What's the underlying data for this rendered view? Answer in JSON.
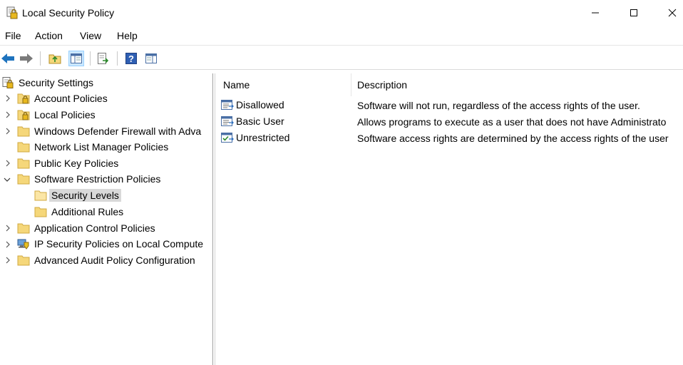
{
  "window": {
    "title": "Local Security Policy",
    "app_icon": "security-policy-icon"
  },
  "menu": [
    "File",
    "Action",
    "View",
    "Help"
  ],
  "toolbar": {
    "icons": [
      "back-icon",
      "forward-icon",
      "up-folder-icon",
      "show-hide-tree-icon",
      "export-list-icon",
      "help-icon",
      "properties-pane-icon"
    ]
  },
  "tree": {
    "root": "Security Settings",
    "items": [
      {
        "label": "Account Policies"
      },
      {
        "label": "Local Policies"
      },
      {
        "label": "Windows Defender Firewall with Adva"
      },
      {
        "label": "Network List Manager Policies"
      },
      {
        "label": "Public Key Policies"
      },
      {
        "label": "Software Restriction Policies"
      },
      {
        "label": "Security Levels"
      },
      {
        "label": "Additional Rules"
      },
      {
        "label": "Application Control Policies"
      },
      {
        "label": "IP Security Policies on Local Compute"
      },
      {
        "label": "Advanced Audit Policy Configuration"
      }
    ]
  },
  "list": {
    "columns": [
      "Name",
      "Description"
    ],
    "rows": [
      {
        "name": "Disallowed",
        "description": "Software will not run, regardless of the access rights of the user."
      },
      {
        "name": "Basic User",
        "description": "Allows programs to execute as a user that does not have Administrato"
      },
      {
        "name": "Unrestricted",
        "description": "Software access rights are determined by the access rights of the user"
      }
    ]
  },
  "colors": {
    "folder": "#f5d77a",
    "folder_border": "#d8b24a",
    "selection": "#d9d9d9",
    "toolbar_active": "#cce8ff",
    "nav_arrow_back": "#1e73be",
    "nav_arrow_forward": "#7a7a7a"
  }
}
